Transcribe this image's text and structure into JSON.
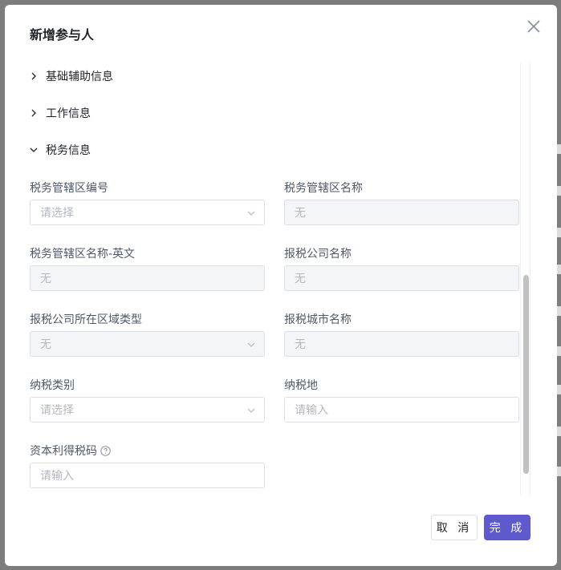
{
  "modal": {
    "title": "新增参与人"
  },
  "sections": [
    {
      "label": "基础辅助信息",
      "expanded": false
    },
    {
      "label": "工作信息",
      "expanded": false
    },
    {
      "label": "税务信息",
      "expanded": true
    }
  ],
  "fields": {
    "tax_district_code": {
      "label": "税务管辖区编号",
      "value": "请选择",
      "type": "select",
      "disabled": false
    },
    "tax_district_name": {
      "label": "税务管辖区名称",
      "value": "无",
      "type": "text",
      "disabled": true
    },
    "tax_district_name_en": {
      "label": "税务管辖区名称-英文",
      "value": "无",
      "type": "text",
      "disabled": true
    },
    "tax_company_name": {
      "label": "报税公司名称",
      "value": "无",
      "type": "text",
      "disabled": true
    },
    "tax_company_region_type": {
      "label": "报税公司所在区域类型",
      "value": "无",
      "type": "select",
      "disabled": true
    },
    "tax_city_name": {
      "label": "报税城市名称",
      "value": "无",
      "type": "text",
      "disabled": true
    },
    "tax_category": {
      "label": "纳税类别",
      "value": "请选择",
      "type": "select",
      "disabled": false
    },
    "tax_location": {
      "label": "纳税地",
      "value": "请输入",
      "type": "text",
      "disabled": false
    },
    "capital_gains_tax_code": {
      "label": "资本利得税码",
      "value": "请输入",
      "type": "text",
      "disabled": false
    }
  },
  "buttons": {
    "cancel": "取 消",
    "ok": "完 成"
  },
  "colors": {
    "primary": "#5e5acb",
    "text": "#1f2329",
    "label": "#4e5969",
    "placeholder": "#b2b8c2",
    "disabled_bg": "#f4f5f7"
  }
}
